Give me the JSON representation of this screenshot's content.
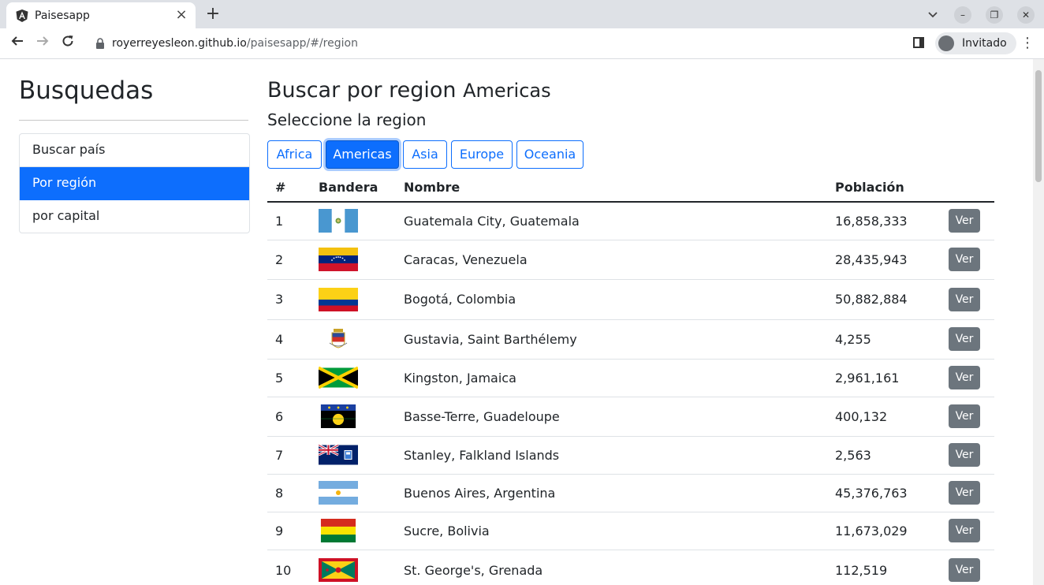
{
  "browser": {
    "tab_title": "Paisesapp",
    "url_host": "royerreyesleon.github.io",
    "url_path": "/paisesapp/#/region",
    "profile_label": "Invitado"
  },
  "sidebar": {
    "title": "Busquedas",
    "items": [
      {
        "label": "Buscar país",
        "active": false
      },
      {
        "label": "Por región",
        "active": true
      },
      {
        "label": "por capital",
        "active": false
      }
    ]
  },
  "main": {
    "title_prefix": "Buscar por region",
    "title_region": "Americas",
    "subtitle": "Seleccione la region",
    "regions": [
      "Africa",
      "Americas",
      "Asia",
      "Europe",
      "Oceania"
    ],
    "active_region": "Americas",
    "table": {
      "headers": [
        "#",
        "Bandera",
        "Nombre",
        "Población",
        ""
      ],
      "button_label": "Ver",
      "rows": [
        {
          "num": "1",
          "name": "Guatemala City, Guatemala",
          "population": "16,858,333",
          "flag": "guatemala-flag"
        },
        {
          "num": "2",
          "name": "Caracas, Venezuela",
          "population": "28,435,943",
          "flag": "venezuela-flag"
        },
        {
          "num": "3",
          "name": "Bogotá, Colombia",
          "population": "50,882,884",
          "flag": "colombia-flag"
        },
        {
          "num": "4",
          "name": "Gustavia, Saint Barthélemy",
          "population": "4,255",
          "flag": "saint-barthelemy-flag"
        },
        {
          "num": "5",
          "name": "Kingston, Jamaica",
          "population": "2,961,161",
          "flag": "jamaica-flag"
        },
        {
          "num": "6",
          "name": "Basse-Terre, Guadeloupe",
          "population": "400,132",
          "flag": "guadeloupe-flag"
        },
        {
          "num": "7",
          "name": "Stanley, Falkland Islands",
          "population": "2,563",
          "flag": "falkland-islands-flag"
        },
        {
          "num": "8",
          "name": "Buenos Aires, Argentina",
          "population": "45,376,763",
          "flag": "argentina-flag"
        },
        {
          "num": "9",
          "name": "Sucre, Bolivia",
          "population": "11,673,029",
          "flag": "bolivia-flag"
        },
        {
          "num": "10",
          "name": "St. George's, Grenada",
          "population": "112,519",
          "flag": "grenada-flag"
        }
      ]
    }
  }
}
